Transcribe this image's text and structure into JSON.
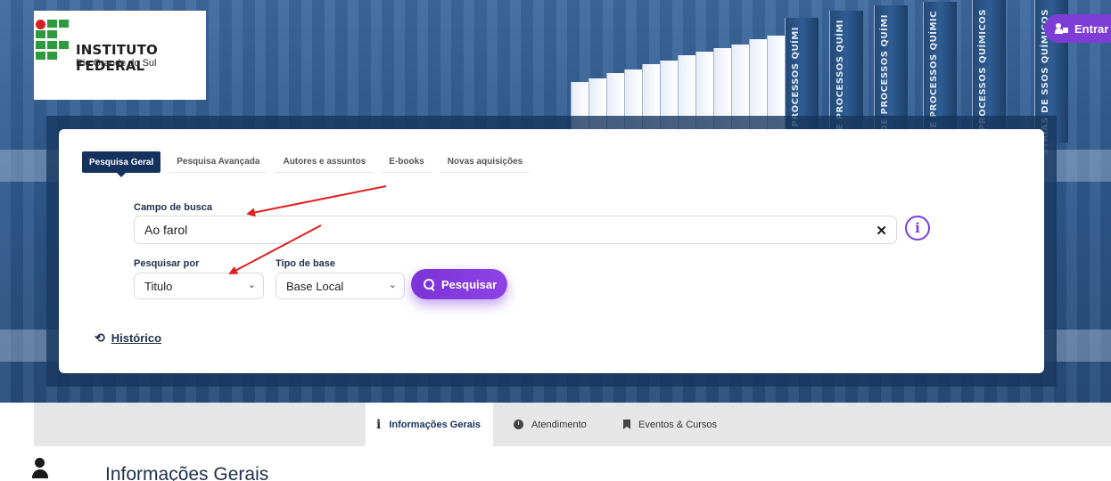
{
  "header": {
    "logo_title": "INSTITUTO FEDERAL",
    "logo_subtitle": "Rio Grande do Sul",
    "login_button": "Entrar",
    "spine_texts": [
      "NDÚSTRIAS DE PROCESSOS QUÍMI",
      "NDÚSTRIAS DE PROCESSOS QUÍMI",
      "NDÚSTRIAS DE PROCESSOS QUÍMI",
      "NDÚSTRIAS DE PROCESSOS QUÍMIC",
      "NDÚSTRIAS DE PROCESSOS QUÍMICOS",
      "STRIAS DE SSOS QUÍMICOS"
    ]
  },
  "search": {
    "tabs": [
      {
        "label": "Pesquisa Geral",
        "active": true
      },
      {
        "label": "Pesquisa Avançada",
        "active": false
      },
      {
        "label": "Autores e assuntos",
        "active": false
      },
      {
        "label": "E-books",
        "active": false
      },
      {
        "label": "Novas aquisições",
        "active": false
      }
    ],
    "field_label": "Campo de busca",
    "field_value": "Ao farol",
    "clear_icon": "close-icon",
    "info_icon": "info-icon",
    "search_by_label": "Pesquisar por",
    "search_by_value": "Titulo",
    "base_type_label": "Tipo de base",
    "base_type_value": "Base Local",
    "submit_label": "Pesquisar",
    "history_label": "Histórico"
  },
  "subnav": {
    "tabs": [
      {
        "label": "Informações Gerais",
        "icon": "info-icon",
        "active": true
      },
      {
        "label": "Atendimento",
        "icon": "clock-icon",
        "active": false
      },
      {
        "label": "Eventos & Cursos",
        "icon": "bookmark-icon",
        "active": false
      }
    ]
  },
  "section": {
    "title": "Informações Gerais"
  },
  "colors": {
    "accent": "#7d3ed8",
    "navy": "#15325f",
    "annotation": "#e02020"
  }
}
